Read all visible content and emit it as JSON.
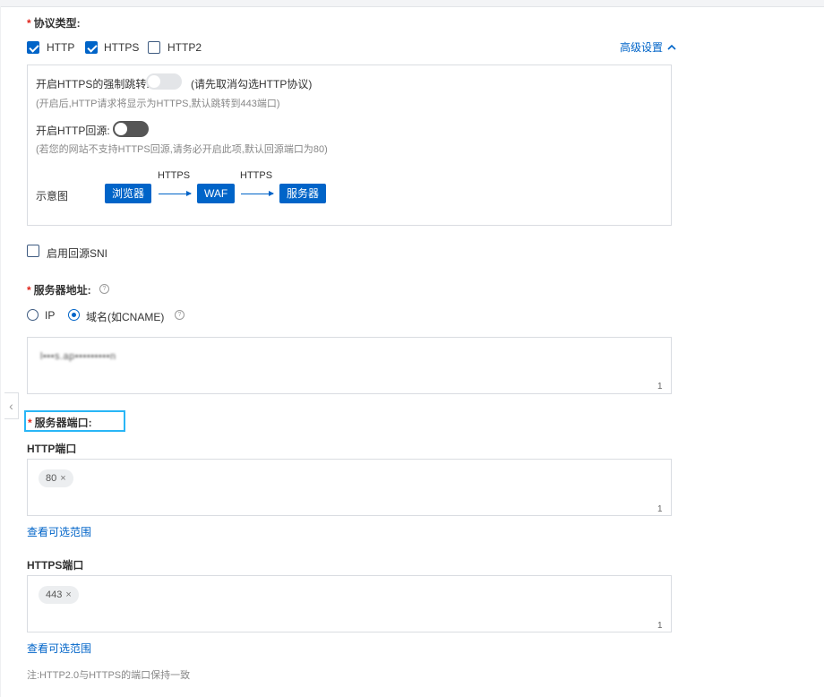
{
  "protocol": {
    "label": "协议类型:",
    "options": [
      {
        "label": "HTTP",
        "checked": true
      },
      {
        "label": "HTTPS",
        "checked": true
      },
      {
        "label": "HTTP2",
        "checked": false
      }
    ],
    "advanced_link": "高级设置"
  },
  "https_redirect": {
    "label": "开启HTTPS的强制跳转:",
    "note_inline": "(请先取消勾选HTTP协议)",
    "hint": "(开启后,HTTP请求将显示为HTTPS,默认跳转到443端口)"
  },
  "http_origin": {
    "label": "开启HTTP回源:",
    "hint": "(若您的网站不支持HTTPS回源,请务必开启此项,默认回源端口为80)"
  },
  "diagram": {
    "label": "示意图",
    "nodes": [
      "浏览器",
      "WAF",
      "服务器"
    ],
    "edge_labels": [
      "HTTPS",
      "HTTPS"
    ]
  },
  "sni": {
    "label": "启用回源SNI",
    "checked": false
  },
  "server_address": {
    "label": "服务器地址:",
    "help": "?",
    "options": [
      {
        "label": "IP",
        "selected": false
      },
      {
        "label": "域名(如CNAME)",
        "selected": true
      }
    ],
    "value_blurred": "l•••s.ap•••••••••n",
    "count": "1"
  },
  "server_port": {
    "label": "服务器端口:",
    "http": {
      "label": "HTTP端口",
      "tags": [
        "80"
      ],
      "count": "1",
      "link": "查看可选范围"
    },
    "https": {
      "label": "HTTPS端口",
      "tags": [
        "443"
      ],
      "count": "1",
      "link": "查看可选范围"
    },
    "note": "注:HTTP2.0与HTTPS的端口保持一致"
  },
  "icons": {
    "collapse": "chevron-up-icon",
    "side": "chevron-left-icon",
    "tag_close": "close-icon"
  },
  "colors": {
    "primary": "#0064c8",
    "required": "#e0231a",
    "focus": "#29b6f6"
  }
}
